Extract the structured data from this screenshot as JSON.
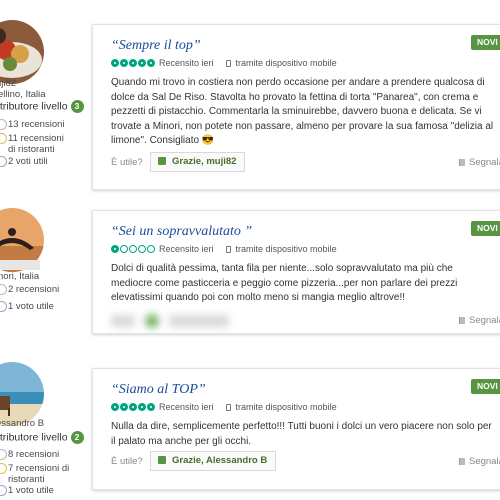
{
  "colors": {
    "accent_green": "#589442",
    "title_blue": "#1a4a9e",
    "rating_green": "#00a680"
  },
  "reviews": [
    {
      "reviewer": {
        "name": "uji82",
        "location": "ellino, Italia",
        "contributor_label": "ntributore livello",
        "level": "3",
        "stats": [
          "13 recensioni",
          "11 recensioni di ristoranti",
          "2 voti utili"
        ]
      },
      "badge": "NOVI",
      "title": "“Sempre il top”",
      "rating": 5,
      "date": "Recensito ieri",
      "device": "tramite dispositivo mobile",
      "body": "Quando mi trovo in costiera non perdo occasione per andare a prendere qualcosa di dolce da Sal De Riso. Stavolta ho provato la fettina di torta \"Panarea\", con crema e pezzetti di pistacchio. Commentarla la sminuirebbe, davvero buona e delicata. Se vi trovate a Minori, non potete non passare, almeno per provare la sua famosa \"delizia al limone\". Consigliato 😎",
      "useful": "È utile?",
      "thanks": "Grazie, muji82",
      "report": "Segnala"
    },
    {
      "reviewer": {
        "location": "nori, Italia",
        "stats": [
          "2 recensioni",
          "1 voto utile"
        ]
      },
      "badge": "NOVI",
      "title": "“Sei un sopravvalutato ”",
      "rating": 1,
      "date": "Recensito ieri",
      "device": "tramite dispositivo mobile",
      "body": "Dolci di qualità pessima, tanta fila per niente...solo sopravvalutato ma più che mediocre come pasticceria e peggio come pizzeria...per non parlare dei prezzi elevatissimi quando poi con molto meno si mangia meglio altrove!!",
      "report": "Segnala"
    },
    {
      "reviewer": {
        "name": "essandro B",
        "contributor_label": "ntributore livello",
        "level": "2",
        "stats": [
          "8 recensioni",
          "7 recensioni di ristoranti",
          "1 voto utile"
        ]
      },
      "badge": "NOVI",
      "title": "“Siamo al TOP”",
      "rating": 5,
      "date": "Recensito ieri",
      "device": "tramite dispositivo mobile",
      "body": "Nulla da dire, semplicemente perfetto!!! Tutti buoni i dolci un vero piacere non solo per il palato ma anche per gli occhi.",
      "useful": "È utile?",
      "thanks": "Grazie, Alessandro B",
      "report": "Segnala"
    }
  ]
}
